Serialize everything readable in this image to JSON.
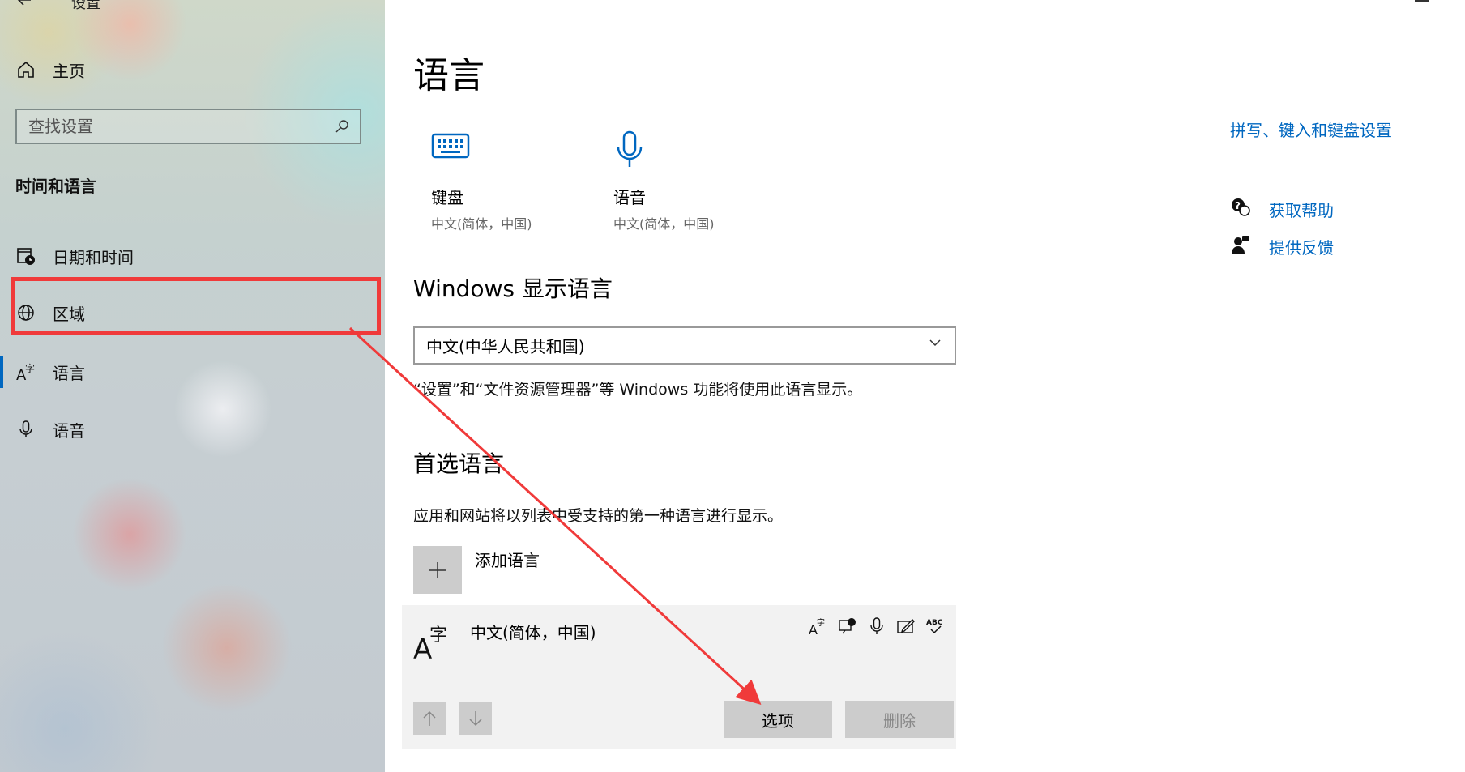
{
  "window": {
    "title": "设置",
    "back_icon": "back-arrow-icon"
  },
  "sidebar": {
    "home_label": "主页",
    "search": {
      "placeholder": "查找设置"
    },
    "section_title": "时间和语言",
    "items": [
      {
        "label": "日期和时间",
        "icon": "calendar-clock-icon"
      },
      {
        "label": "区域",
        "icon": "globe-icon"
      },
      {
        "label": "语言",
        "icon": "language-icon",
        "selected": true
      },
      {
        "label": "语音",
        "icon": "microphone-icon"
      }
    ]
  },
  "main": {
    "title": "语言",
    "tiles": [
      {
        "name": "键盘",
        "sub": "中文(简体，中国)",
        "icon": "keyboard-icon"
      },
      {
        "name": "语音",
        "sub": "中文(简体，中国)",
        "icon": "microphone-icon"
      }
    ],
    "display_language": {
      "heading": "Windows 显示语言",
      "selected": "中文(中华人民共和国)",
      "note": "“设置”和“文件资源管理器”等 Windows 功能将使用此语言显示。"
    },
    "preferred": {
      "heading": "首选语言",
      "note": "应用和网站将以列表中受支持的第一种语言进行显示。",
      "add_label": "添加语言",
      "languages": [
        {
          "name": "中文(简体，中国)",
          "options_label": "选项",
          "remove_label": "删除"
        }
      ]
    }
  },
  "right_panel": {
    "spelling_link": "拼写、键入和键盘设置",
    "help_label": "获取帮助",
    "feedback_label": "提供反馈"
  },
  "colors": {
    "accent": "#0067c0",
    "annotation": "#f03a3a"
  }
}
